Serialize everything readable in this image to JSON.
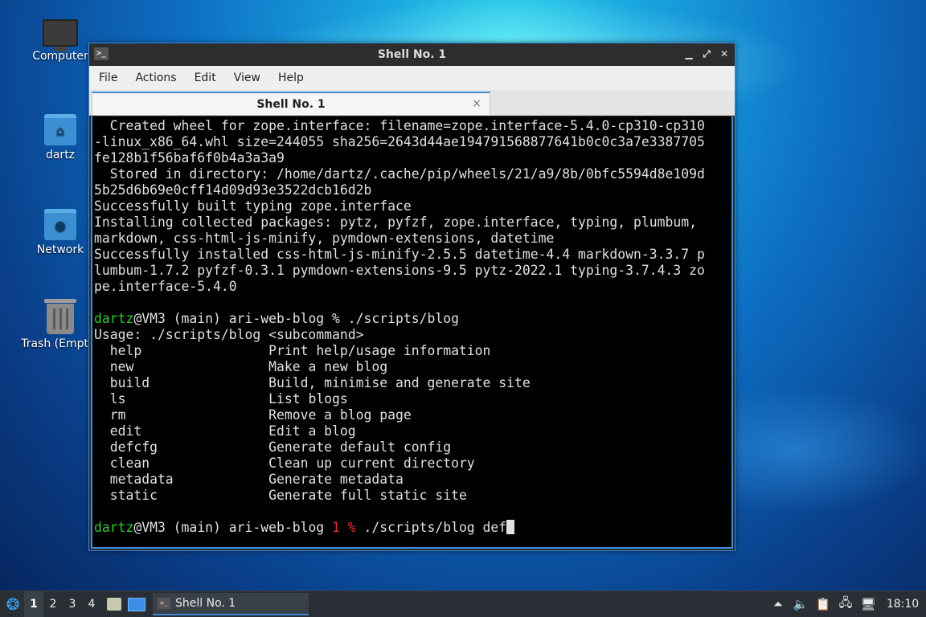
{
  "desktop": {
    "icons": [
      {
        "label": "Computer",
        "icon": "computer-icon"
      },
      {
        "label": "dartz",
        "icon": "home-folder-icon"
      },
      {
        "label": "Network",
        "icon": "network-folder-icon"
      },
      {
        "label": "Trash (Empty)",
        "icon": "trash-icon"
      }
    ]
  },
  "window": {
    "title": "Shell No. 1",
    "menu": [
      "File",
      "Actions",
      "Edit",
      "View",
      "Help"
    ],
    "tab_label": "Shell No. 1",
    "tab_close": "×"
  },
  "terminal": {
    "lines": [
      "  Created wheel for zope.interface: filename=zope.interface-5.4.0-cp310-cp310",
      "-linux_x86_64.whl size=244055 sha256=2643d44ae194791568877641b0c0c3a7e3387705",
      "fe128b1f56baf6f0b4a3a3a9",
      "  Stored in directory: /home/dartz/.cache/pip/wheels/21/a9/8b/0bfc5594d8e109d",
      "5b25d6b69e0cff14d09d93e3522dcb16d2b",
      "Successfully built typing zope.interface",
      "Installing collected packages: pytz, pyfzf, zope.interface, typing, plumbum,",
      "markdown, css-html-js-minify, pymdown-extensions, datetime",
      "Successfully installed css-html-js-minify-2.5.5 datetime-4.4 markdown-3.3.7 p",
      "lumbum-1.7.2 pyfzf-0.3.1 pymdown-extensions-9.5 pytz-2022.1 typing-3.7.4.3 zo",
      "pe.interface-5.4.0",
      ""
    ],
    "prompt1": {
      "user": "dartz",
      "rest": "@VM3 (main) ari-web-blog % ./scripts/blog"
    },
    "usage": "Usage: ./scripts/blog <subcommand>",
    "commands": [
      {
        "name": "help",
        "desc": "Print help/usage information"
      },
      {
        "name": "new",
        "desc": "Make a new blog"
      },
      {
        "name": "build",
        "desc": "Build, minimise and generate site"
      },
      {
        "name": "ls",
        "desc": "List blogs"
      },
      {
        "name": "rm",
        "desc": "Remove a blog page"
      },
      {
        "name": "edit",
        "desc": "Edit a blog"
      },
      {
        "name": "defcfg",
        "desc": "Generate default config"
      },
      {
        "name": "clean",
        "desc": "Clean up current directory"
      },
      {
        "name": "metadata",
        "desc": "Generate metadata"
      },
      {
        "name": "static",
        "desc": "Generate full static site"
      }
    ],
    "prompt2": {
      "user": "dartz",
      "mid": "@VM3 (main) ari-web-blog ",
      "status": "1 %",
      "input": " ./scripts/blog def"
    }
  },
  "taskbar": {
    "workspaces": [
      "1",
      "2",
      "3",
      "4"
    ],
    "active_workspace": "1",
    "task_label": "Shell No. 1",
    "clock": "18:10"
  }
}
